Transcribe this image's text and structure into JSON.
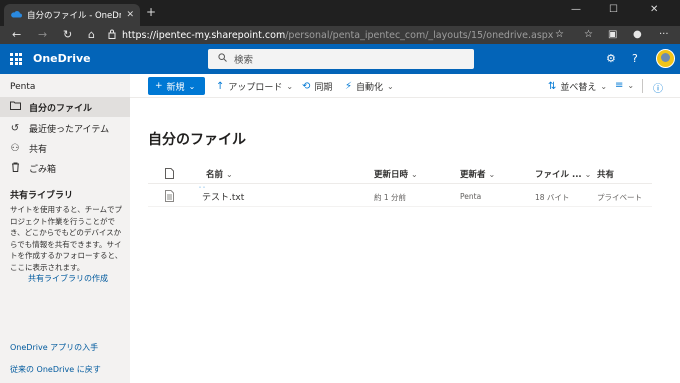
{
  "browser": {
    "tab_title": "自分のファイル - OneDrive",
    "tab_close": "✕",
    "new_tab": "+",
    "url_host": "https://ipentec-my.sharepoint.com",
    "url_path": "/personal/penta_ipentec_com/_layouts/15/onedrive.aspx"
  },
  "suite": {
    "brand": "OneDrive",
    "search_placeholder": "検索"
  },
  "leftnav": {
    "user": "Penta",
    "items": [
      {
        "label": "自分のファイル",
        "icon": "folder-icon"
      },
      {
        "label": "最近使ったアイテム",
        "icon": "clock-icon"
      },
      {
        "label": "共有",
        "icon": "people-icon"
      },
      {
        "label": "ごみ箱",
        "icon": "trash-icon"
      }
    ],
    "shared_libraries_title": "共有ライブラリ",
    "shared_libraries_desc": "サイトを使用すると、チームでプロジェクト作業を行うことができ、どこからでもどのデバイスからでも情報を共有できます。サイトを作成するかフォローすると、ここに表示されます。",
    "create_shared_library": "共有ライブラリの作成",
    "get_apps": "OneDrive アプリの入手",
    "return_classic": "従来の OneDrive に戻す"
  },
  "commandbar": {
    "new": "新規",
    "upload": "アップロード",
    "sync": "同期",
    "automate": "自動化",
    "sort": "並べ替え"
  },
  "main": {
    "title": "自分のファイル",
    "columns": [
      "名前",
      "更新日時",
      "更新者",
      "ファイル ...",
      "共有"
    ],
    "rows": [
      {
        "name": "テスト.txt",
        "modified": "約 1 分前",
        "modified_by": "Penta",
        "size": "18 バイト",
        "sharing": "プライベート"
      }
    ]
  },
  "colors": {
    "suite_blue": "#0364b8",
    "primary_button": "#0078d4",
    "link": "#005a9e",
    "nav_bg": "#f3f2f1",
    "nav_active": "#e1dfdd"
  }
}
